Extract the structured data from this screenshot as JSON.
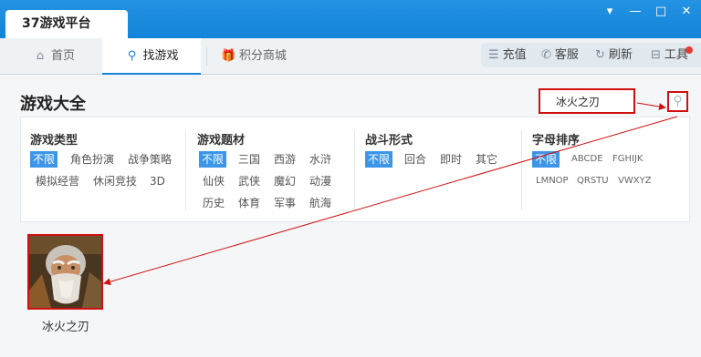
{
  "window": {
    "title": "37游戏平台",
    "buttons": {
      "menu": "▾",
      "minimize": "—",
      "maximize": "□",
      "close": "✕"
    }
  },
  "nav": {
    "tabs": [
      {
        "label": "首页",
        "icon": "home-icon"
      },
      {
        "label": "找游戏",
        "icon": "search-icon"
      },
      {
        "label": "积分商城",
        "icon": "gift-icon"
      }
    ],
    "active_tab": "找游戏"
  },
  "toolbar": {
    "items": [
      {
        "label": "充值",
        "icon": "coin-stack-icon"
      },
      {
        "label": "客服",
        "icon": "phone-icon"
      },
      {
        "label": "刷新",
        "icon": "refresh-icon"
      },
      {
        "label": "工具",
        "icon": "toolbox-icon"
      }
    ],
    "notification_dot_color": "#e53935"
  },
  "page": {
    "title": "游戏大全"
  },
  "search": {
    "value": "冰火之刃",
    "button_icon": "magnifier-icon"
  },
  "filters": {
    "type": {
      "heading": "游戏类型",
      "options": [
        "不限",
        "角色扮演",
        "战争策略",
        "模拟经营",
        "休闲竞技",
        "3D"
      ],
      "selected": "不限"
    },
    "theme": {
      "heading": "游戏题材",
      "options": [
        "不限",
        "三国",
        "西游",
        "水浒",
        "仙侠",
        "武侠",
        "魔幻",
        "动漫",
        "历史",
        "体育",
        "军事",
        "航海"
      ],
      "selected": "不限"
    },
    "combat": {
      "heading": "战斗形式",
      "options": [
        "不限",
        "回合",
        "即时",
        "其它"
      ],
      "selected": "不限"
    },
    "alpha": {
      "heading": "字母排序",
      "options": [
        "不限",
        "ABCDE",
        "FGHIJK",
        "LMNOP",
        "QRSTU",
        "VWXYZ"
      ],
      "selected": "不限"
    }
  },
  "results": [
    {
      "name": "冰火之刃",
      "icon": "old-warrior-portrait"
    }
  ],
  "colors": {
    "title_bar": "#1383d8",
    "selected_filter": "#3d95e8",
    "annotation_red": "#d01010"
  }
}
